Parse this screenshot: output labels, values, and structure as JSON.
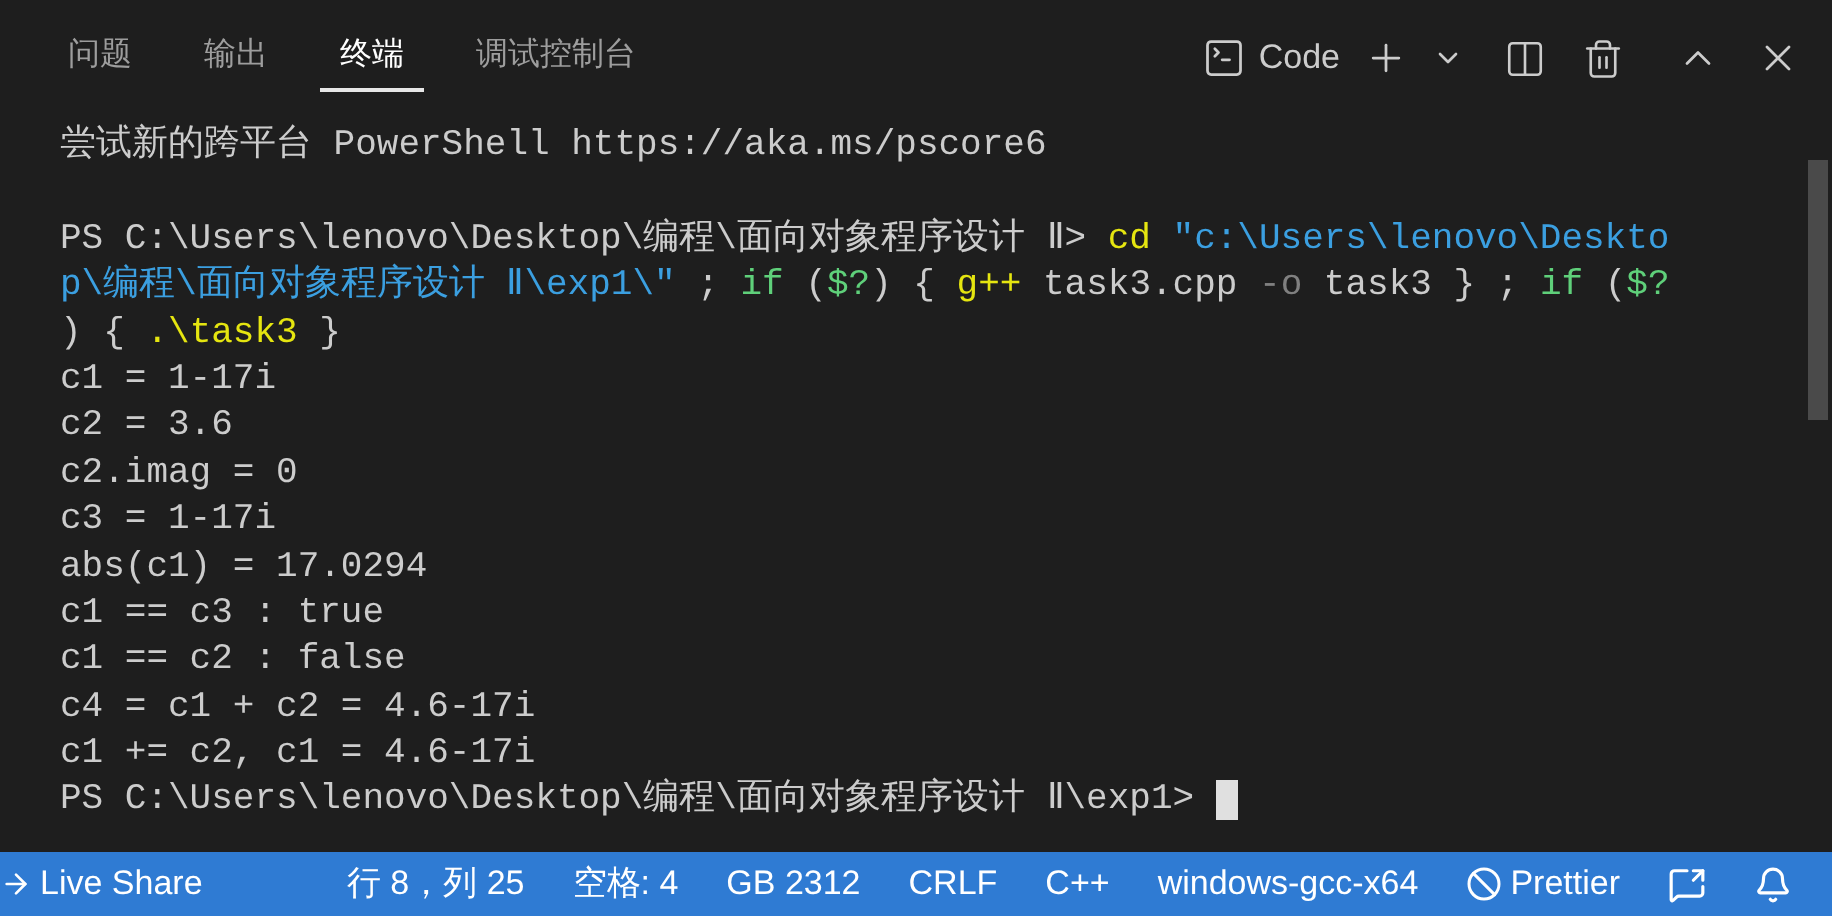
{
  "tabs": [
    {
      "label": "问题",
      "selected": false
    },
    {
      "label": "输出",
      "selected": false
    },
    {
      "label": "终端",
      "selected": true
    },
    {
      "label": "调试控制台",
      "selected": false
    }
  ],
  "toolbar": {
    "shell_label": "Code"
  },
  "terminal": {
    "lines": [
      [
        {
          "kind": "plain",
          "text": "尝试新的跨平台 PowerShell https://aka.ms/pscore6"
        }
      ],
      [
        {
          "kind": "blank"
        }
      ],
      [
        {
          "kind": "plain",
          "text": "PS C:\\Users\\lenovo\\Desktop\\编程\\面向对象程序设计 Ⅱ> "
        },
        {
          "kind": "command",
          "text": "cd"
        },
        {
          "kind": "string",
          "text": " \"c:\\Users\\lenovo\\Deskto"
        }
      ],
      [
        {
          "kind": "string",
          "text": "p\\编程\\面向对象程序设计 Ⅱ\\exp1\\\""
        },
        {
          "kind": "plain",
          "text": " ; "
        },
        {
          "kind": "keyword",
          "text": "if"
        },
        {
          "kind": "plain",
          "text": " ("
        },
        {
          "kind": "keyword",
          "text": "$?"
        },
        {
          "kind": "plain",
          "text": ") { "
        },
        {
          "kind": "command",
          "text": "g++"
        },
        {
          "kind": "plain",
          "text": " task3.cpp "
        },
        {
          "kind": "param",
          "text": "-o"
        },
        {
          "kind": "plain",
          "text": " task3 } ; "
        },
        {
          "kind": "keyword",
          "text": "if"
        },
        {
          "kind": "plain",
          "text": " ("
        },
        {
          "kind": "keyword",
          "text": "$?"
        }
      ],
      [
        {
          "kind": "plain",
          "text": ") { "
        },
        {
          "kind": "command",
          "text": ".\\task3"
        },
        {
          "kind": "plain",
          "text": " }"
        }
      ],
      [
        {
          "kind": "plain",
          "text": "c1 = 1-17i"
        }
      ],
      [
        {
          "kind": "plain",
          "text": "c2 = 3.6"
        }
      ],
      [
        {
          "kind": "plain",
          "text": "c2.imag = 0"
        }
      ],
      [
        {
          "kind": "plain",
          "text": "c3 = 1-17i"
        }
      ],
      [
        {
          "kind": "plain",
          "text": "abs(c1) = 17.0294"
        }
      ],
      [
        {
          "kind": "plain",
          "text": "c1 == c3 : true"
        }
      ],
      [
        {
          "kind": "plain",
          "text": "c1 == c2 : false"
        }
      ],
      [
        {
          "kind": "plain",
          "text": "c4 = c1 + c2 = 4.6-17i"
        }
      ],
      [
        {
          "kind": "plain",
          "text": "c1 += c2, c1 = 4.6-17i"
        }
      ],
      [
        {
          "kind": "plain",
          "text": "PS C:\\Users\\lenovo\\Desktop\\编程\\面向对象程序设计 Ⅱ\\exp1> "
        },
        {
          "kind": "cursor"
        }
      ]
    ]
  },
  "status_bar": {
    "left": [
      {
        "kind": "live_share",
        "text": "Live Share"
      }
    ],
    "right": [
      {
        "kind": "text",
        "text": "行 8，列 25"
      },
      {
        "kind": "text",
        "text": "空格: 4"
      },
      {
        "kind": "text",
        "text": "GB 2312"
      },
      {
        "kind": "text",
        "text": "CRLF"
      },
      {
        "kind": "text",
        "text": "C++"
      },
      {
        "kind": "text",
        "text": "windows-gcc-x64"
      },
      {
        "kind": "prettier",
        "text": "Prettier"
      },
      {
        "kind": "feedback"
      },
      {
        "kind": "bell"
      }
    ]
  }
}
